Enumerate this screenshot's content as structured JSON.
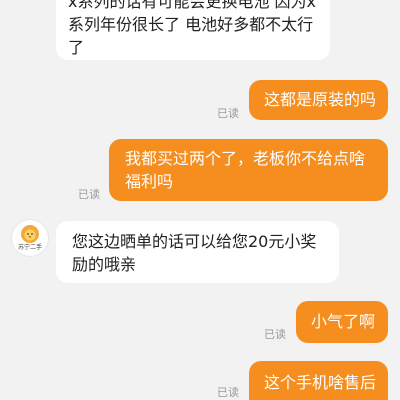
{
  "messages": [
    {
      "id": "m1",
      "from": "seller",
      "text": "x系列的话有可能会更换电池 因为x系列年份很长了  电池好多都不太行了",
      "status": ""
    },
    {
      "id": "m2",
      "from": "me",
      "text": "这都是原装的吗",
      "status": "已读"
    },
    {
      "id": "m3",
      "from": "me",
      "text": "我都买过两个了，老板你不给点啥福利吗",
      "status": "已读"
    },
    {
      "id": "m4",
      "from": "seller",
      "text": "您这边晒单的话可以给您20元小奖励的哦亲",
      "status": ""
    },
    {
      "id": "m5",
      "from": "me",
      "text": "小气了啊",
      "status": "已读"
    },
    {
      "id": "m6",
      "from": "me",
      "text": "这个手机啥售后",
      "status": "已读"
    }
  ],
  "seller": {
    "avatar_label": "苏宁二手",
    "avatar_icon": "lion-mascot-icon"
  },
  "colors": {
    "outgoing_bubble": "#f58e1f",
    "incoming_bubble": "#ffffff",
    "background": "#f2f2f2",
    "read_status": "#9a9a9a"
  }
}
